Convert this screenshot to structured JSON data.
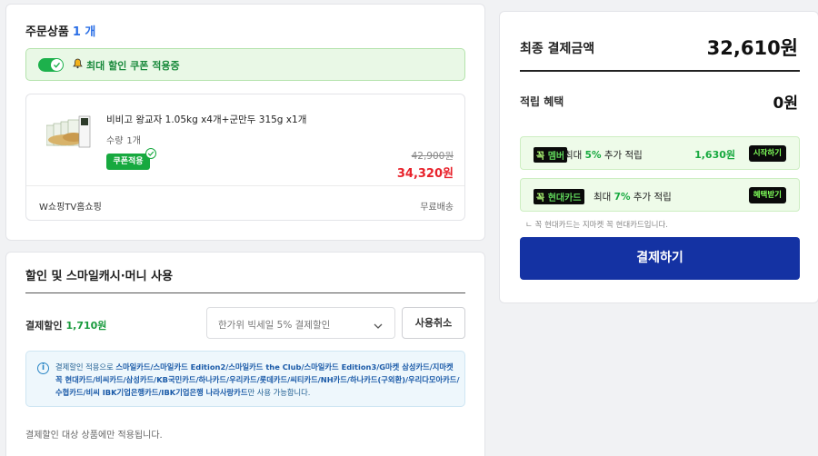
{
  "order": {
    "title": "주문상품",
    "count": "1 개",
    "coupon_banner": "최대 할인 쿠폰 적용중",
    "product": {
      "name": "비비고 왕교자 1.05kg x4개+군만두 315g x1개",
      "qty_label": "수량",
      "qty_value": "1개",
      "coupon_tag": "쿠폰적용",
      "original_price": "42,900원",
      "sale_price": "34,320원",
      "seller": "W쇼핑TV홈쇼핑",
      "shipping": "무료배송"
    }
  },
  "discount": {
    "title": "할인 및 스마일캐시·머니 사용",
    "pay_discount_label": "결제할인",
    "pay_discount_amount": "1,710원",
    "select_value": "한가위 빅세일 5% 결제할인",
    "cancel_button": "사용취소",
    "info_prefix": "결제할인 적용으로 ",
    "info_cards": "스마일카드/스마일카드 Edition2/스마일카드 the Club/스마일카드 Edition3/G마켓 삼성카드/지마켓 꼭 현대카드/비씨카드/삼성카드/KB국민카드/하나카드/우리카드/롯데카드/씨티카드/NH카드/하나카드(구외환)/우리다모아카드/수협카드/비씨 IBK기업은행카드/IBK기업은행 나라사랑카드",
    "info_suffix": "만 사용 가능합니다.",
    "note": "결제할인 대상 상품에만 적용됩니다."
  },
  "summary": {
    "final_label": "최종 결제금액",
    "final_amount": "32,610원",
    "reward_label": "적립 혜택",
    "reward_amount": "0원",
    "promos": [
      {
        "brand_a": "꼭",
        "brand_b": "멤버",
        "desc_pre": "최대 ",
        "desc_rate": "5%",
        "desc_post": " 추가 적립",
        "amount": "1,630원",
        "button": "시작하기"
      },
      {
        "brand_a": "꼭",
        "brand_b": "현대카드",
        "desc_pre": "최대 ",
        "desc_rate": "7%",
        "desc_post": " 추가 적립",
        "amount": "",
        "button": "혜택받기"
      }
    ],
    "card_note": "ㄴ 꼭 현대카드는 지마켓 꼭 현대카드입니다.",
    "pay_button": "결제하기"
  },
  "colors": {
    "primary_button": "#1432a3",
    "green_accent": "#17a93f",
    "sale_red": "#e8222b",
    "count_blue": "#2b6fe6"
  },
  "icons": [
    "toggle-switch",
    "bell-icon",
    "check-icon",
    "chevron-down-icon",
    "info-icon"
  ]
}
